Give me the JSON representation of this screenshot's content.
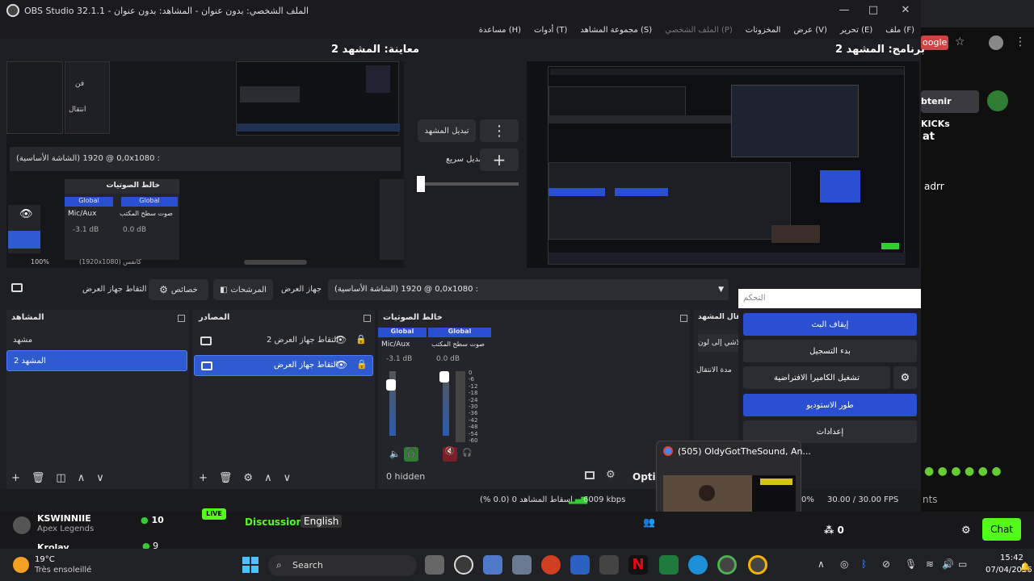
{
  "window": {
    "title": "OBS Studio 32.1.1 - الملف الشخصي: بدون عنوان - المشاهد: بدون عنوان",
    "controls": {
      "minimize": "—",
      "maximize": "□",
      "close": "✕"
    }
  },
  "menu": [
    {
      "label": "ملف (F)",
      "dim": false
    },
    {
      "label": "تحرير (E)",
      "dim": false
    },
    {
      "label": "عرض (V)",
      "dim": false
    },
    {
      "label": "المخزونات",
      "dim": false
    },
    {
      "label": "الملف الشخصي (P)",
      "dim": true
    },
    {
      "label": "مجموعة المشاهد (S)",
      "dim": false
    },
    {
      "label": "أدوات (T)",
      "dim": false
    },
    {
      "label": "مساعدة (H)",
      "dim": false
    }
  ],
  "preview": {
    "title": "معاينة: المشهد 2"
  },
  "program": {
    "title": "برنامج: المشهد 2"
  },
  "transition": {
    "scene_button": "تبديل المشهد",
    "quick_label": "تبديل سريع",
    "menu_glyph": "⋮",
    "add_glyph": "+"
  },
  "nested": {
    "display_label": "(الشاشة الأساسية) 0,0 @ 1920x1080 :",
    "mixer_title": "خالط الصوتيات",
    "global1": "Global",
    "global2": "Global",
    "mic": "Mic/Aux",
    "desktop": "صوت سطح المكتب",
    "db1": "-3.1 dB",
    "db2": "0.0 dB",
    "zoom": "100%",
    "res": "(1920x1080) كانفس",
    "side1": "فن",
    "side2": "انتقال"
  },
  "sourcebar": {
    "capture_label": "التقاط جهاز العرض",
    "properties": "خصائص",
    "filters": "المرشحات",
    "display_device": "جهاز العرض",
    "display_value": "(الشاشة الأساسية) 0,0 @ 1920x1080 :"
  },
  "controls_panel": {
    "header": "التحكم",
    "stop_stream": "إيقاف البث",
    "start_record": "بدء التسجيل",
    "virtual_cam": "تشغيل الكاميرا الافتراضية",
    "studio_mode": "طور الاستوديو",
    "settings": "إعدادات"
  },
  "scenes": {
    "header": "المشاهد",
    "items": [
      "مشهد",
      "المشهد 2"
    ],
    "selected_index": 1
  },
  "sources": {
    "header": "المصادر",
    "items": [
      "التقاط جهاز العرض 2",
      "التقاط جهاز العرض"
    ],
    "selected_index": 1
  },
  "mixer": {
    "header": "خالط الصوتيات",
    "channels": [
      {
        "tag": "Global",
        "name": "Mic/Aux",
        "db": "-3.1 dB"
      },
      {
        "tag": "Global",
        "name": "صوت سطح المكتب",
        "db": "0.0 dB"
      }
    ],
    "hidden": "0 hidden",
    "scale": [
      "0",
      "-6",
      "-12",
      "-18",
      "-24",
      "-30",
      "-36",
      "-42",
      "-48",
      "-54",
      "-60"
    ]
  },
  "transitions_dock": {
    "header": "انتقال المشهد",
    "item1": "تلاشي إلى لون",
    "item2": "مدة الانتقال"
  },
  "optio_label": "Optio",
  "status": {
    "dropped": "إسقاط المشاهد 0 (0.0 %)",
    "kbps": "6009 kbps",
    "cpu": "0%",
    "fps": "30.00 / 30.00 FPS"
  },
  "popup": {
    "title": "(505) OldyGotTheSound, An..."
  },
  "stream_bar": {
    "user": "KSWINNIIE",
    "game": "Apex Legends",
    "count": "10",
    "live_badge": "LIVE",
    "discussion": "Discussion",
    "language": "English",
    "user2": "Krolay",
    "count2": "9",
    "viewers": "0",
    "chat_button": "Chat"
  },
  "right_edge": {
    "google": "oogle",
    "kicks": "btenir KICKs",
    "chat": "at",
    "adrr": "adrr",
    "nts": "nts"
  },
  "weather": {
    "temp": "19°C",
    "desc": "Très ensoleillé"
  },
  "taskbar": {
    "search": "Search",
    "time": "15:42",
    "date": "07/04/2026"
  }
}
